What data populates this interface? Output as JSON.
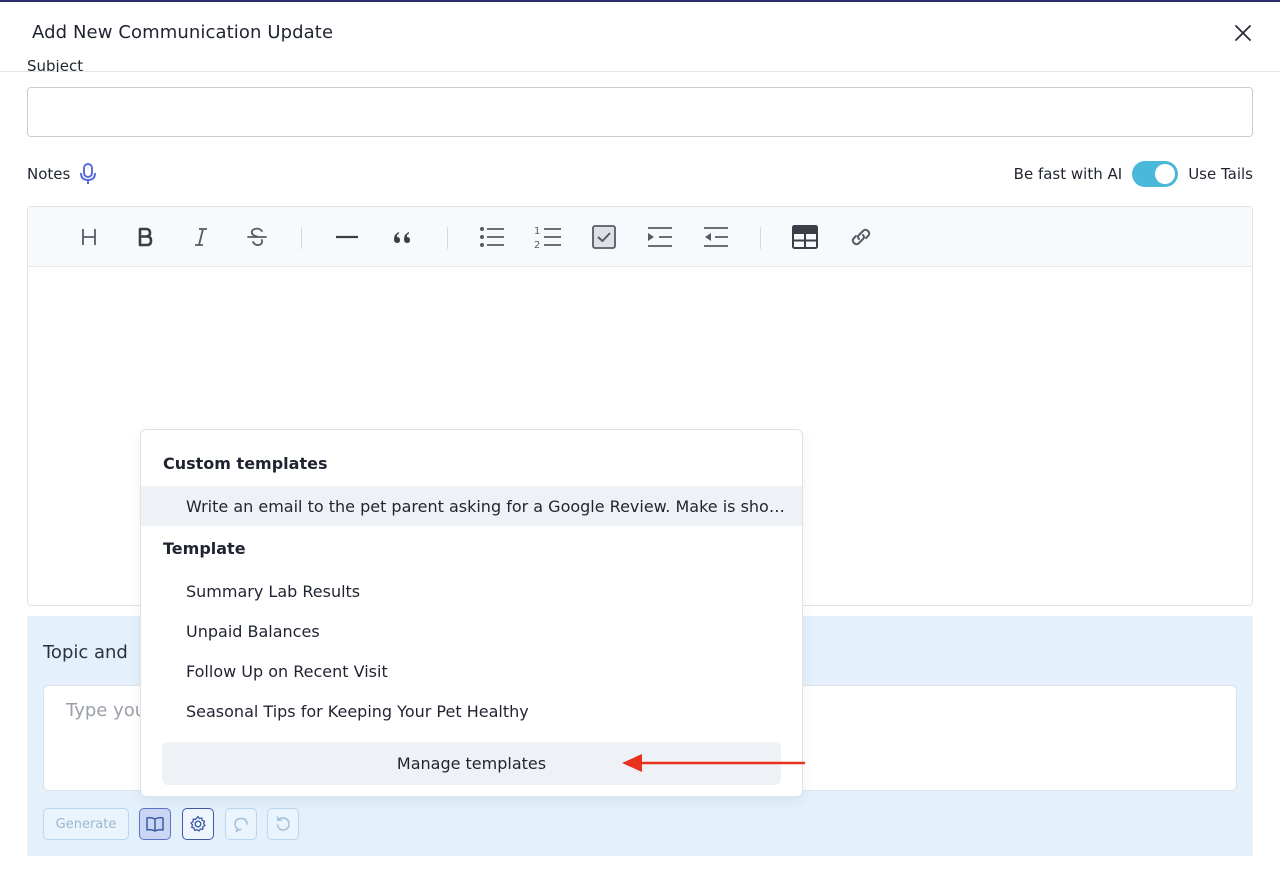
{
  "modal": {
    "title": "Add New Communication Update"
  },
  "subject": {
    "value": ""
  },
  "notes": {
    "label": "Notes"
  },
  "ai": {
    "label": "Be fast with AI",
    "toggle_label": "Use Tails",
    "toggle_on": true
  },
  "toolbar": {
    "items": [
      "heading-icon",
      "bold-icon",
      "italic-icon",
      "strikethrough-icon",
      "horizontal-rule-icon",
      "quote-icon",
      "bullet-list-icon",
      "numbered-list-icon",
      "checklist-icon",
      "indent-icon",
      "outdent-icon",
      "table-icon",
      "link-icon"
    ]
  },
  "topic": {
    "label": "Topic and",
    "placeholder": "Type you"
  },
  "actions": {
    "generate_label": "Generate"
  },
  "templates": {
    "custom_heading": "Custom templates",
    "custom_items": [
      "Write an email to the pet parent asking for a Google Review. Make is short and friendly."
    ],
    "template_heading": "Template",
    "template_items": [
      "Summary Lab Results",
      "Unpaid Balances",
      "Follow Up on Recent Visit",
      "Seasonal Tips for Keeping Your Pet Healthy"
    ],
    "manage_label": "Manage templates"
  },
  "colors": {
    "accent": "#4ab8d8",
    "annotation_arrow": "#e8321e",
    "panel_bg": "#e4f1fc"
  }
}
